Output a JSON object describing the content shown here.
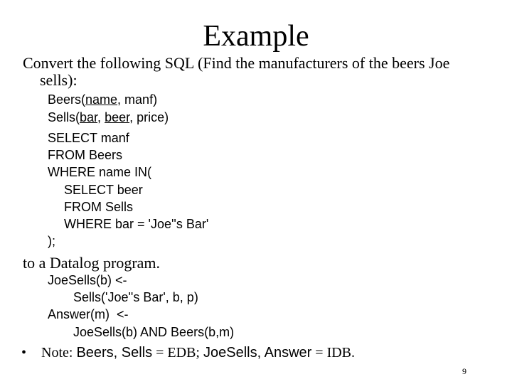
{
  "slide": {
    "title": "Example",
    "intro_line1": "Convert the following SQL (Find the manufacturers of the beers Joe",
    "intro_line2": "sells):",
    "schema": {
      "beers": {
        "prefix": "Beers(",
        "key": "name",
        "rest": ", manf)"
      },
      "sells": {
        "prefix": "Sells(",
        "key1": "bar",
        "sep": ", ",
        "key2": "beer",
        "rest": ", price)"
      }
    },
    "sql_lines": [
      "SELECT manf",
      "FROM Beers",
      "WHERE name IN(",
      "SELECT beer",
      "FROM Sells",
      "WHERE bar = 'Joe''s Bar'",
      ");"
    ],
    "transition": "to a Datalog program.",
    "datalog_lines": [
      "JoeSells(b) <-",
      "Sells('Joe''s Bar', b, p)",
      "Answer(m)  <-",
      "JoeSells(b) AND Beers(b,m)"
    ],
    "note": {
      "bullet": "•",
      "label": "Note: ",
      "edb_rels": "Beers, Sells",
      "edb_eq": " = EDB; ",
      "idb_rels": "JoeSells, Answer",
      "idb_eq": " = IDB."
    },
    "page_number": "9"
  }
}
